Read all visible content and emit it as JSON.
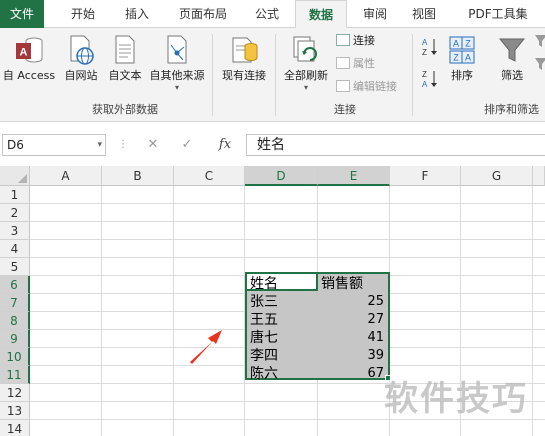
{
  "tabs": [
    {
      "label": "文件",
      "state": "file"
    },
    {
      "label": "开始",
      "state": "normal"
    },
    {
      "label": "插入",
      "state": "normal"
    },
    {
      "label": "页面布局",
      "state": "normal"
    },
    {
      "label": "公式",
      "state": "normal"
    },
    {
      "label": "数据",
      "state": "active"
    },
    {
      "label": "审阅",
      "state": "normal"
    },
    {
      "label": "视图",
      "state": "normal"
    },
    {
      "label": "PDF工具集",
      "state": "normal"
    }
  ],
  "ribbon": {
    "get_external": {
      "from_access": "自 Access",
      "from_web": "自网站",
      "from_text": "自文本",
      "from_other": "自其他来源",
      "group_label": "获取外部数据"
    },
    "existing": {
      "label": "现有连接"
    },
    "connections": {
      "refresh_all": "全部刷新",
      "connections": "连接",
      "properties": "属性",
      "edit_links": "编辑链接",
      "group_label": "连接"
    },
    "sort_filter": {
      "sort": "排序",
      "filter": "筛选",
      "group_label": "排序和筛选"
    }
  },
  "formula_bar": {
    "name_box": "D6",
    "fx": "fx",
    "content": "姓名"
  },
  "grid": {
    "columns": [
      "A",
      "B",
      "C",
      "D",
      "E",
      "F",
      "G"
    ],
    "selected_columns": [
      "D",
      "E"
    ],
    "rows": [
      "1",
      "2",
      "3",
      "4",
      "5",
      "6",
      "7",
      "8",
      "9",
      "10",
      "11",
      "12",
      "13",
      "14"
    ],
    "selected_rows": [
      "6",
      "7",
      "8",
      "9",
      "10",
      "11"
    ],
    "headers": {
      "name": "姓名",
      "sales": "销售额"
    },
    "data": [
      {
        "name": "张三",
        "sales": "25"
      },
      {
        "name": "王五",
        "sales": "27"
      },
      {
        "name": "唐七",
        "sales": "41"
      },
      {
        "name": "李四",
        "sales": "39"
      },
      {
        "name": "陈六",
        "sales": "67"
      }
    ]
  },
  "watermark": "软件技巧",
  "colors": {
    "accent": "#217346",
    "arrow": "#e8331f",
    "selection": "#c6c6c6"
  }
}
